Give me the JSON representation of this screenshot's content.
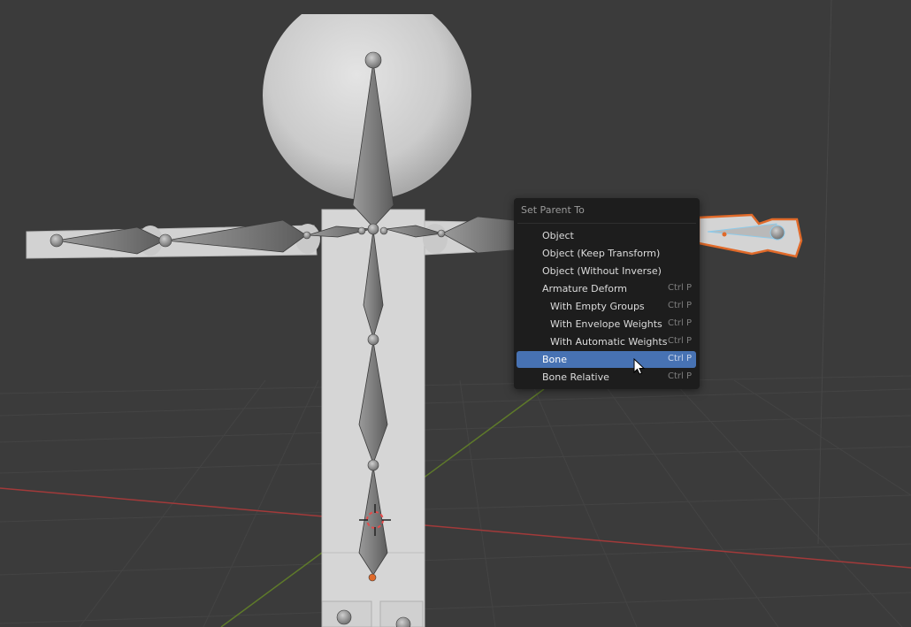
{
  "menu": {
    "title": "Set Parent To",
    "items": [
      {
        "label": "Object",
        "shortcut": "",
        "indent": false,
        "active": false
      },
      {
        "label": "Object (Keep Transform)",
        "shortcut": "",
        "indent": false,
        "active": false
      },
      {
        "label": "Object (Without Inverse)",
        "shortcut": "",
        "indent": false,
        "active": false
      },
      {
        "label": "Armature Deform",
        "shortcut": "Ctrl P",
        "indent": false,
        "active": false
      },
      {
        "label": "With Empty Groups",
        "shortcut": "Ctrl P",
        "indent": true,
        "active": false
      },
      {
        "label": "With Envelope Weights",
        "shortcut": "Ctrl P",
        "indent": true,
        "active": false
      },
      {
        "label": "With Automatic Weights",
        "shortcut": "Ctrl P",
        "indent": true,
        "active": false
      },
      {
        "label": "Bone",
        "shortcut": "Ctrl P",
        "indent": false,
        "active": true
      },
      {
        "label": "Bone Relative",
        "shortcut": "Ctrl P",
        "indent": false,
        "active": false
      }
    ]
  },
  "colors": {
    "viewport_bg": "#3b3b3b",
    "menu_bg": "#1d1d1d",
    "highlight": "#4772b3",
    "selection_outline": "#e06a2a",
    "x_axis": "#a23a3a",
    "y_axis": "#5e7a2a"
  },
  "icons": [
    "mouse-cursor-icon",
    "3d-cursor-icon"
  ]
}
